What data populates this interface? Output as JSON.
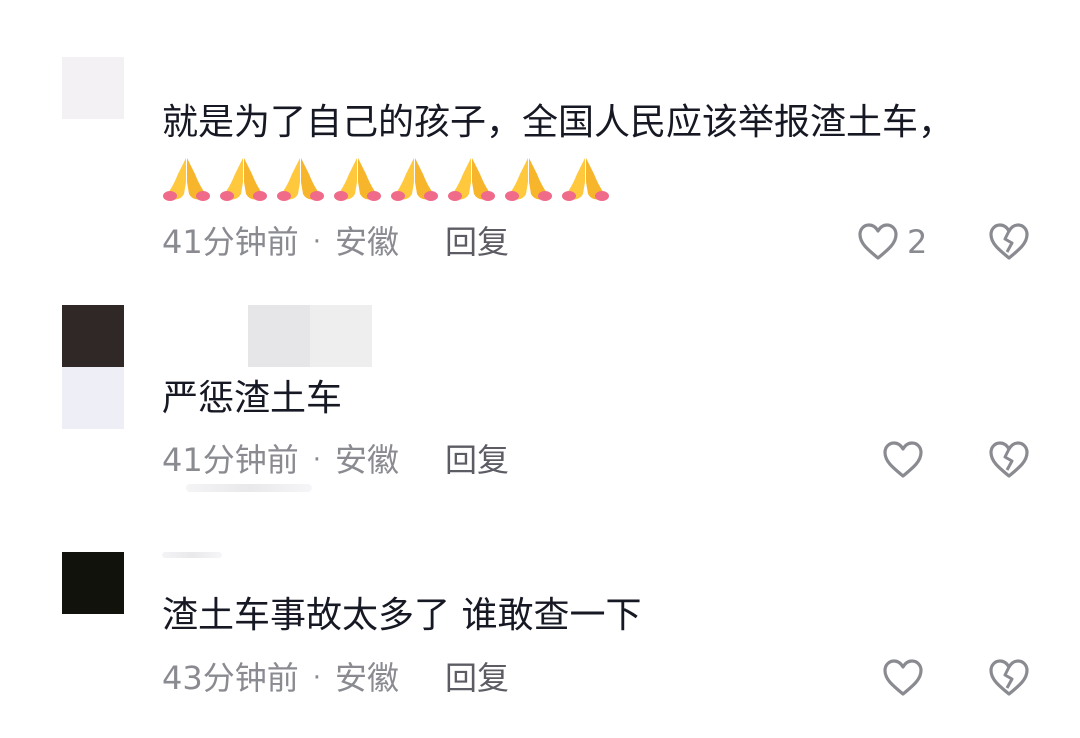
{
  "comments": [
    {
      "text": "就是为了自己的孩子，全国人民应该举报渣土车，",
      "emoji_count": 8,
      "time": "41分钟前",
      "location": "安徽",
      "reply_label": "回复",
      "like_count": "2"
    },
    {
      "text": "严惩渣土车",
      "time": "41分钟前",
      "location": "安徽",
      "reply_label": "回复",
      "like_count": ""
    },
    {
      "text": "渣土车事故太多了 谁敢查一下",
      "time": "43分钟前",
      "location": "安徽",
      "reply_label": "回复",
      "like_count": ""
    }
  ],
  "separator": "·",
  "icons": {
    "like": "heart-outline-icon",
    "dislike": "broken-heart-icon",
    "emoji": "folded-hands-emoji"
  },
  "colors": {
    "text": "#161823",
    "meta": "#8a8b91",
    "icon": "#8a8b91"
  }
}
